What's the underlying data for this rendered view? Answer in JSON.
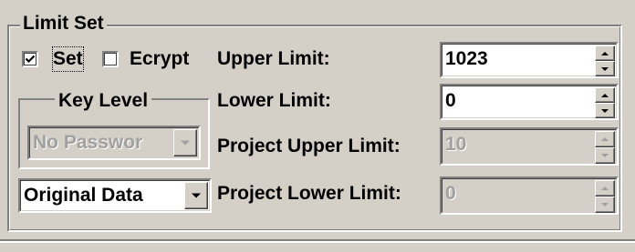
{
  "group": {
    "title": "Limit Set"
  },
  "options": {
    "set": {
      "label": "Set",
      "checked": true
    },
    "encrypt": {
      "label": "Ecrypt",
      "checked": false
    }
  },
  "key_level": {
    "title": "Key Level",
    "selected": "No Passwor",
    "enabled": false
  },
  "data_mode": {
    "selected": "Original Data"
  },
  "limits": {
    "upper": {
      "label": "Upper Limit:",
      "value": "1023",
      "enabled": true
    },
    "lower": {
      "label": "Lower Limit:",
      "value": "0",
      "enabled": true
    },
    "project_upper": {
      "label": "Project Upper Limit:",
      "value": "10",
      "enabled": false
    },
    "project_lower": {
      "label": "Project Lower Limit:",
      "value": "0",
      "enabled": false
    }
  },
  "icons": {
    "check": "checkmark-icon",
    "spin_up": "spin-up-arrow-icon",
    "spin_down": "spin-down-arrow-icon",
    "dropdown": "dropdown-arrow-icon"
  },
  "colors": {
    "face": "#d4d0c8",
    "disabled_text": "#a0a0a0",
    "field_bg": "#ffffff"
  }
}
